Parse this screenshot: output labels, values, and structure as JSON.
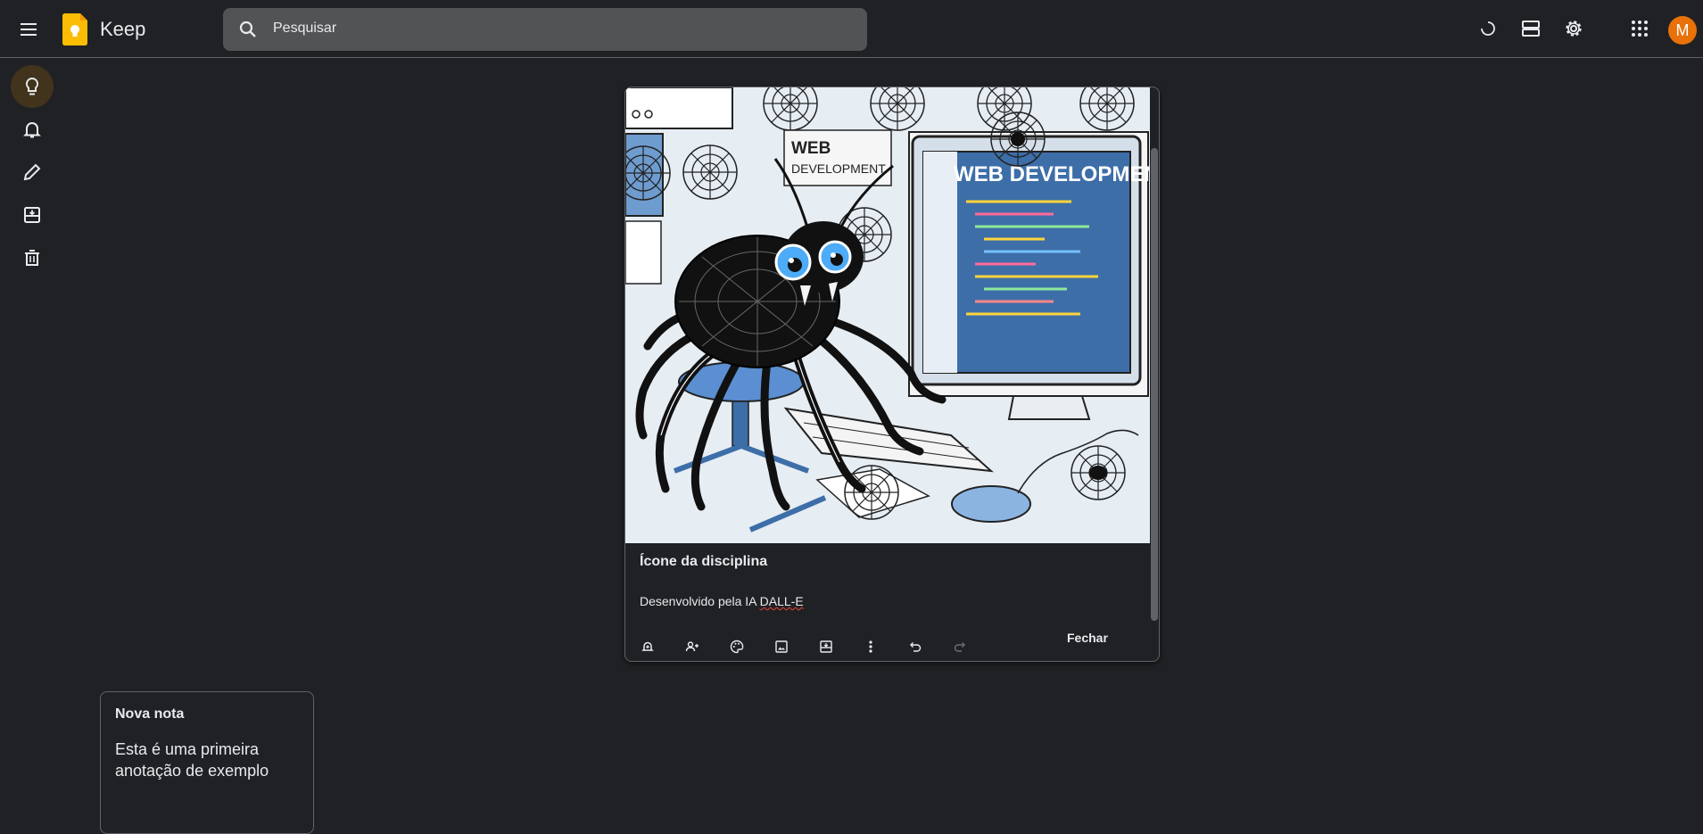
{
  "app": {
    "name": "Keep"
  },
  "search": {
    "placeholder": "Pesquisar"
  },
  "profile": {
    "initial": "M",
    "color": "#e8710a"
  },
  "sidebar": {
    "items": [
      {
        "name": "Notas",
        "icon": "bulb-icon",
        "active": true
      },
      {
        "name": "Lembretes",
        "icon": "bell-icon"
      },
      {
        "name": "Editar marcadores",
        "icon": "pencil-icon"
      },
      {
        "name": "Arquivo",
        "icon": "archive-icon"
      },
      {
        "name": "Lixeira",
        "icon": "trash-icon"
      }
    ]
  },
  "open_note": {
    "title": "Ícone da disciplina",
    "body_prefix": "Desenvolvido pela IA ",
    "body_flagged": "DALL-E",
    "close_label": "Fechar",
    "image": {
      "lettering_sign": "WEB DEVELOPMENT",
      "lettering_monitor": "WEB DEVELOPMENT"
    }
  },
  "notes": [
    {
      "title": "Nova nota",
      "body": "Esta é uma primeira anotação de exemplo"
    }
  ],
  "colors": {
    "background": "#202124",
    "accent": "#fbbc04",
    "active_nav": "#41331c"
  }
}
